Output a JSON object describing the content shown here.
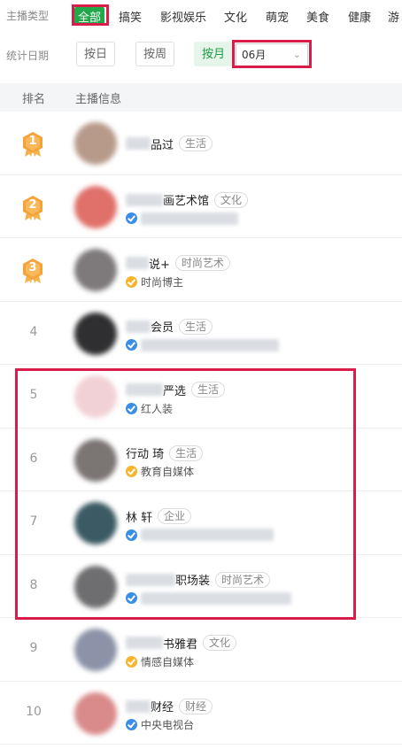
{
  "filters": {
    "category_label": "主播类型",
    "categories": [
      "全部",
      "搞笑",
      "影视娱乐",
      "文化",
      "萌宠",
      "美食",
      "健康",
      "游"
    ],
    "date_label": "统计日期",
    "period_buttons": [
      "按日",
      "按周",
      "按月"
    ],
    "selected_period": "按月",
    "month_value": "06月"
  },
  "table": {
    "headers": [
      "排名",
      "主播信息"
    ]
  },
  "anchors": [
    {
      "rank": "1",
      "name": "品过",
      "tag": "生活",
      "sub": ""
    },
    {
      "rank": "2",
      "name": "画艺术馆",
      "tag": "文化",
      "sub": ""
    },
    {
      "rank": "3",
      "name": "说+",
      "tag": "时尚艺术",
      "sub": "时尚博主"
    },
    {
      "rank": "4",
      "name": "会员",
      "tag": "生活",
      "sub": ""
    },
    {
      "rank": "5",
      "name": "严选",
      "tag": "生活",
      "sub": "红人装"
    },
    {
      "rank": "6",
      "name": "行动  琦",
      "tag": "生活",
      "sub": "教育自媒体"
    },
    {
      "rank": "7",
      "name": "林  轩",
      "tag": "企业",
      "sub": ""
    },
    {
      "rank": "8",
      "name": "职场装",
      "tag": "时尚艺术",
      "sub": ""
    },
    {
      "rank": "9",
      "name": "书雅君",
      "tag": "文化",
      "sub": "情感自媒体"
    },
    {
      "rank": "10",
      "name": "财经",
      "tag": "财经",
      "sub": "中央电视台"
    }
  ],
  "colors": {
    "accent_green": "#21a84a",
    "highlight_red": "#d81d4a",
    "verified_blue": "#3b8ee6",
    "verified_gold": "#f5b52e",
    "medal_orange": "#f6a23a"
  }
}
